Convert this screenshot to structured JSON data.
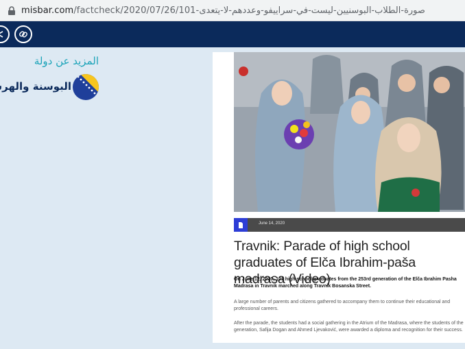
{
  "browser": {
    "url_domain": "misbar.com",
    "url_path": "/factcheck/2020/07/26/101-صورة-الطلاب-البوسنيين-ليست-في-سراييفو-وعددهم-لا-يتعدى",
    "lock_icon": "lock-icon"
  },
  "navbar": {
    "icons": [
      "share-circle-icon",
      "link-circle-icon"
    ]
  },
  "sidebar": {
    "title": "المزيد عن دولة",
    "country": "البوسنة والهرسك",
    "flag_icon": "bosnia-flag-icon"
  },
  "article": {
    "date": "June 14, 2020",
    "title": "Travnik: Parade of high school graduates of Elča Ibrahim-paša madrasa (Video)",
    "lead": "On June 12, 2020, 101 high school graduates from the 253rd generation of the Elča Ibrahim Pasha Madrasa in Travnik marched along Travnik Bosanska Street.",
    "paragraph1": "A large number of parents and citizens gathered to accompany them to continue their educational and professional careers.",
    "paragraph2": "After the parade, the students had a social gathering in the Atrium of the Madrasa, where the students of the generation, Safija Dogan and Ahmed Ljevaković, were awarded a diploma and recognition for their success."
  },
  "colors": {
    "navbar": "#0b2a5b",
    "accent": "#1aa3b8",
    "badge": "#2d3dd6"
  }
}
